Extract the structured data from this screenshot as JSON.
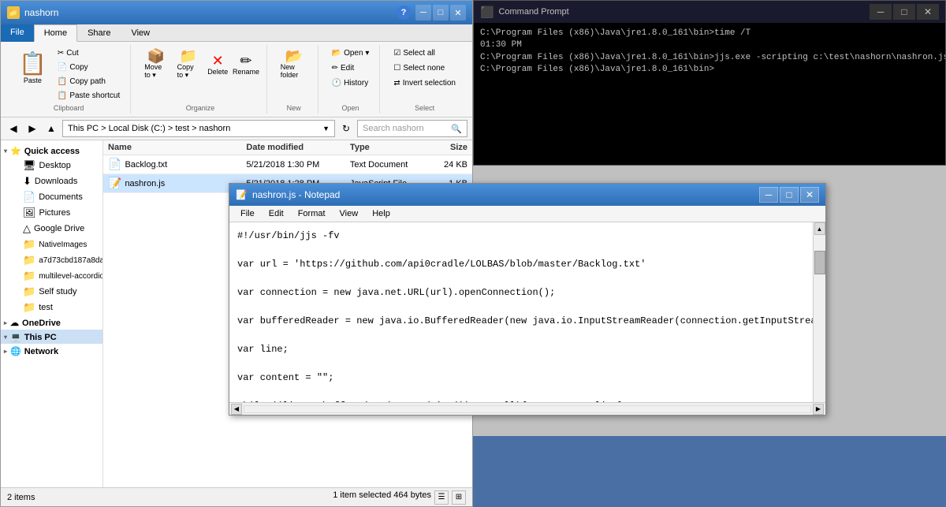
{
  "explorer": {
    "title": "nashorn",
    "tabs": [
      "File",
      "Home",
      "Share",
      "View"
    ],
    "active_tab": "Home",
    "ribbon": {
      "clipboard": {
        "paste": "Paste",
        "cut": "Cut",
        "copy": "Copy",
        "copy_path": "Copy path",
        "paste_shortcut": "Paste shortcut",
        "group_label": "Clipboard"
      },
      "organize": {
        "move_to": "Move to ▾",
        "copy_to": "Copy to ▾",
        "delete": "Delete",
        "rename": "Rename",
        "group_label": "Organize"
      },
      "new": {
        "new_folder": "New folder",
        "group_label": "New"
      },
      "open": {
        "open": "Open ▾",
        "edit": "Edit",
        "history": "History",
        "group_label": "Open"
      },
      "select": {
        "select_all": "Select all",
        "select_none": "Select none",
        "invert": "Invert selection",
        "group_label": "Select"
      }
    },
    "address": {
      "path": "This PC > Local Disk (C:) > test > nashorn",
      "search_placeholder": "Search nashorn"
    },
    "sidebar": {
      "items": [
        {
          "label": "Quick access",
          "icon": "⭐",
          "expanded": true
        },
        {
          "label": "Desktop",
          "icon": "🖥",
          "indent": true
        },
        {
          "label": "Downloads",
          "icon": "⬇",
          "indent": true
        },
        {
          "label": "Documents",
          "icon": "📄",
          "indent": true
        },
        {
          "label": "Pictures",
          "icon": "🖼",
          "indent": true
        },
        {
          "label": "Google Drive",
          "icon": "△",
          "indent": true
        },
        {
          "label": "NativeImages",
          "icon": "📁",
          "indent": true
        },
        {
          "label": "a7d73cbd187a8da",
          "icon": "📁",
          "indent": true
        },
        {
          "label": "multilevel-accordio",
          "icon": "📁",
          "indent": true
        },
        {
          "label": "Self study",
          "icon": "📁",
          "indent": true
        },
        {
          "label": "test",
          "icon": "📁",
          "indent": true
        },
        {
          "label": "OneDrive",
          "icon": "☁",
          "expanded": false
        },
        {
          "label": "This PC",
          "icon": "💻",
          "expanded": true,
          "selected": true
        },
        {
          "label": "Network",
          "icon": "🌐",
          "expanded": false
        }
      ]
    },
    "files": {
      "columns": [
        "Name",
        "Date modified",
        "Type",
        "Size"
      ],
      "rows": [
        {
          "name": "Backlog.txt",
          "icon": "📄",
          "date": "5/21/2018 1:30 PM",
          "type": "Text Document",
          "size": "24 KB",
          "selected": false
        },
        {
          "name": "nashron.js",
          "icon": "📝",
          "date": "5/21/2018 1:28 PM",
          "type": "JavaScript File",
          "size": "1 KB",
          "selected": true
        }
      ]
    },
    "status": {
      "left": "2 items",
      "right": "1 item selected  464 bytes"
    }
  },
  "cmd": {
    "title": "Command Prompt",
    "lines": [
      "C:\\Program Files (x86)\\Java\\jre1.8.0_161\\bin>time /T",
      "01:30 PM",
      "",
      "C:\\Program Files (x86)\\Java\\jre1.8.0_161\\bin>jjs.exe -scripting c:\\test\\nashorn\\nashron.js",
      "",
      "C:\\Program Files (x86)\\Java\\jre1.8.0_161\\bin>"
    ]
  },
  "notepad": {
    "title": "nashron.js - Notepad",
    "menu": [
      "File",
      "Edit",
      "Format",
      "View",
      "Help"
    ],
    "content": "#!/usr/bin/jjs -fv\n\nvar url = 'https://github.com/api0cradle/LOLBAS/blob/master/Backlog.txt'\n\nvar connection = new java.net.URL(url).openConnection();\n\nvar bufferedReader = new java.io.BufferedReader(new java.io.InputStreamReader(connection.getInputStream()));\n\nvar line;\n\nvar content = \"\";\n\nwhile ((line = bufferedReader.readLine()) != null){ content += line}\n\nout = new java.io.PrintWriter(\"c:\\\\test\\\\nashorn\\\\Backlog.txt\");\n\nout.print(content)"
  }
}
